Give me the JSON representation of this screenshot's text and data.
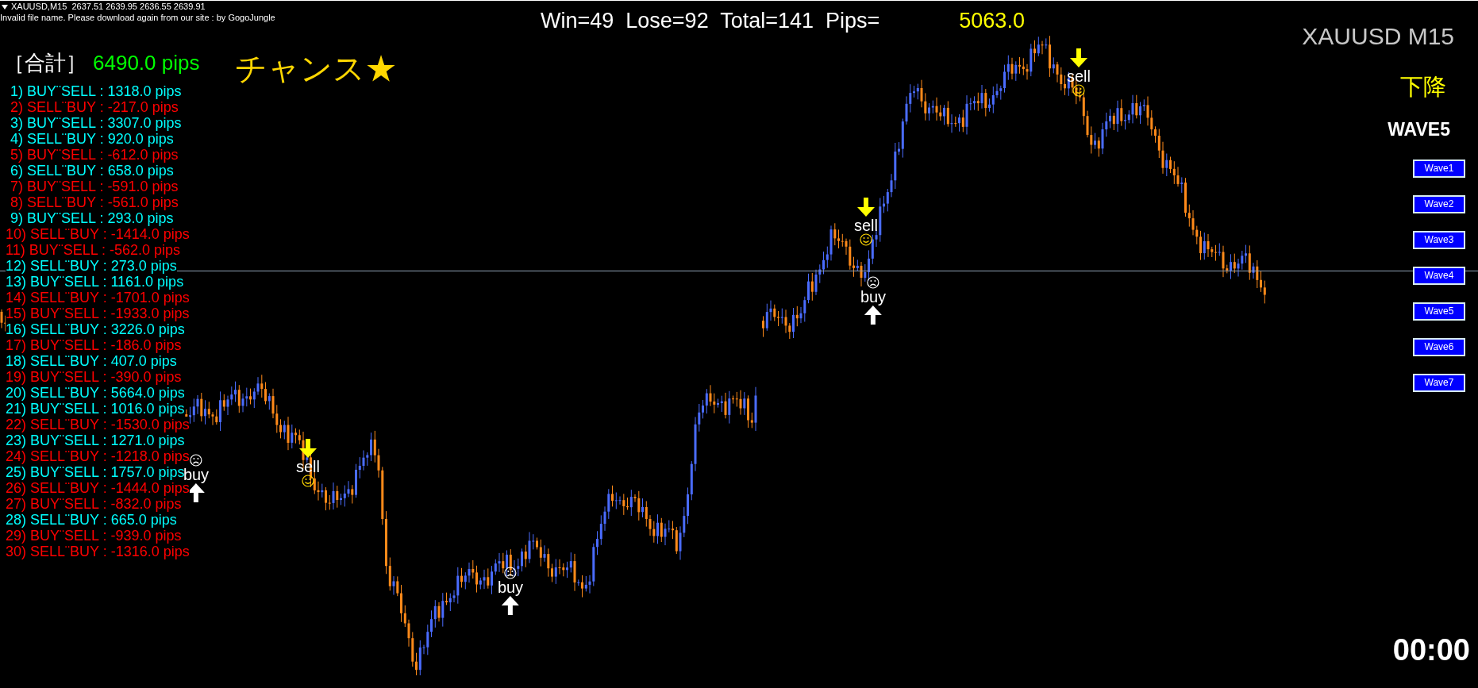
{
  "chart_header": {
    "symbol_line": "XAUUSD,M15  2637.51 2639.95 2636.55 2639.91",
    "message": "Invalid file name. Please download again from our site : by GogoJungle"
  },
  "stats": {
    "summary": "Win=49  Lose=92  Total=141  Pips=",
    "pips": "5063.0"
  },
  "total": {
    "label": "［合計］",
    "value": "6490.0 pips"
  },
  "signal": "チャンス★",
  "trades": [
    {
      "text": "1) BUY¨SELL : 1318.0 pips",
      "color": "#00ffff"
    },
    {
      "text": "2) SELL¨BUY : -217.0 pips",
      "color": "#ff0000"
    },
    {
      "text": "3) BUY¨SELL : 3307.0 pips",
      "color": "#00ffff"
    },
    {
      "text": "4) SELL¨BUY : 920.0 pips",
      "color": "#00ffff"
    },
    {
      "text": "5) BUY¨SELL : -612.0 pips",
      "color": "#ff0000"
    },
    {
      "text": "6) SELL¨BUY : 658.0 pips",
      "color": "#00ffff"
    },
    {
      "text": "7) BUY¨SELL : -591.0 pips",
      "color": "#ff0000"
    },
    {
      "text": "8) SELL¨BUY : -561.0 pips",
      "color": "#ff0000"
    },
    {
      "text": "9) BUY¨SELL : 293.0 pips",
      "color": "#00ffff"
    },
    {
      "text": "10) SELL¨BUY : -1414.0 pips",
      "color": "#ff0000"
    },
    {
      "text": "11) BUY¨SELL : -562.0 pips",
      "color": "#ff0000"
    },
    {
      "text": "12) SELL¨BUY : 273.0 pips",
      "color": "#00ffff"
    },
    {
      "text": "13) BUY¨SELL : 1161.0 pips",
      "color": "#00ffff"
    },
    {
      "text": "14) SELL¨BUY : -1701.0 pips",
      "color": "#ff0000"
    },
    {
      "text": "15) BUY¨SELL : -1933.0 pips",
      "color": "#ff0000"
    },
    {
      "text": "16) SELL¨BUY : 3226.0 pips",
      "color": "#00ffff"
    },
    {
      "text": "17) BUY¨SELL : -186.0 pips",
      "color": "#ff0000"
    },
    {
      "text": "18) SELL¨BUY : 407.0 pips",
      "color": "#00ffff"
    },
    {
      "text": "19) BUY¨SELL : -390.0 pips",
      "color": "#ff0000"
    },
    {
      "text": "20) SELL¨BUY : 5664.0 pips",
      "color": "#00ffff"
    },
    {
      "text": "21) BUY¨SELL : 1016.0 pips",
      "color": "#00ffff"
    },
    {
      "text": "22) SELL¨BUY : -1530.0 pips",
      "color": "#ff0000"
    },
    {
      "text": "23) BUY¨SELL : 1271.0 pips",
      "color": "#00ffff"
    },
    {
      "text": "24) SELL¨BUY : -1218.0 pips",
      "color": "#ff0000"
    },
    {
      "text": "25) BUY¨SELL : 1757.0 pips",
      "color": "#00ffff"
    },
    {
      "text": "26) SELL¨BUY : -1444.0 pips",
      "color": "#ff0000"
    },
    {
      "text": "27) BUY¨SELL : -832.0 pips",
      "color": "#ff0000"
    },
    {
      "text": "28) SELL¨BUY : 665.0 pips",
      "color": "#00ffff"
    },
    {
      "text": "29) BUY¨SELL : -939.0 pips",
      "color": "#ff0000"
    },
    {
      "text": "30) SELL¨BUY : -1316.0 pips",
      "color": "#ff0000"
    }
  ],
  "markers": [
    {
      "kind": "buy",
      "label": "buy"
    },
    {
      "kind": "sell",
      "label": "sell"
    },
    {
      "kind": "buy",
      "label": "buy"
    },
    {
      "kind": "sell",
      "label": "sell"
    },
    {
      "kind": "buy",
      "label": "buy"
    },
    {
      "kind": "sell",
      "label": "sell"
    }
  ],
  "symbol": "XAUUSD M15",
  "trend": "下降",
  "wave": "WAVE5",
  "wave_buttons": [
    "Wave1",
    "Wave2",
    "Wave3",
    "Wave4",
    "Wave5",
    "Wave6",
    "Wave7"
  ],
  "timer": "00:00"
}
